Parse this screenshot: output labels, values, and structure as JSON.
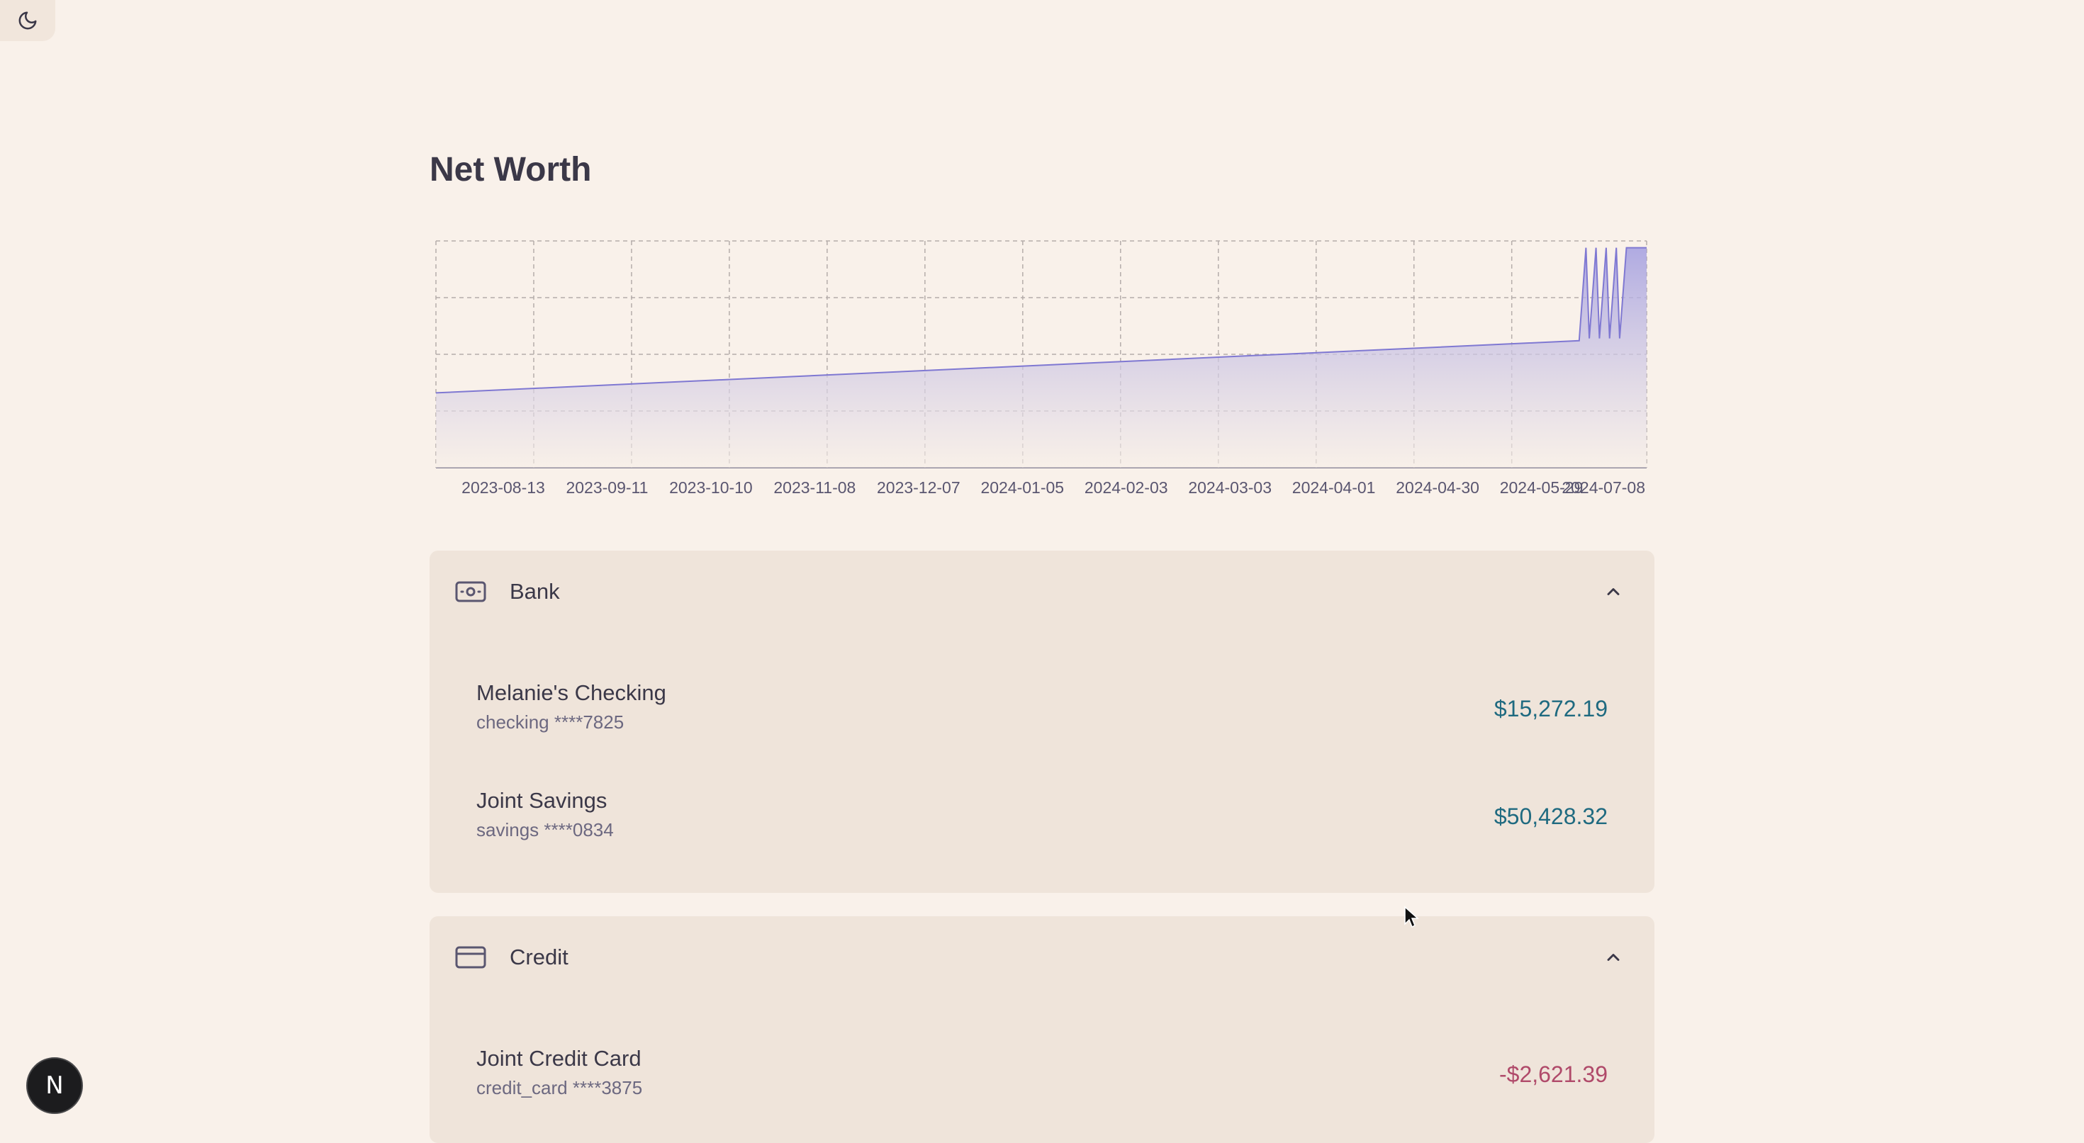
{
  "theme_toggle": {
    "icon": "moon-icon"
  },
  "page": {
    "title": "Net Worth"
  },
  "chart_data": {
    "type": "area",
    "title": "",
    "xlabel": "",
    "ylabel": "",
    "grid": true,
    "x_tick_labels": [
      "2023-08-13",
      "2023-09-11",
      "2023-10-10",
      "2023-11-08",
      "2023-12-07",
      "2024-01-05",
      "2024-02-03",
      "2024-03-03",
      "2024-04-01",
      "2024-04-30",
      "2024-05-29",
      "2024-07-08"
    ],
    "x_range": [
      "2023-07-15",
      "2024-07-08"
    ],
    "y_range": [
      0,
      1
    ],
    "series": [
      {
        "x": [
          "2023-07-15",
          "2024-06-18",
          "2024-06-20",
          "2024-06-21",
          "2024-06-23",
          "2024-06-24",
          "2024-06-26",
          "2024-06-27",
          "2024-06-29",
          "2024-06-30",
          "2024-07-02",
          "2024-07-08"
        ],
        "values": [
          0.33,
          0.56,
          0.97,
          0.57,
          0.97,
          0.57,
          0.97,
          0.57,
          0.97,
          0.57,
          0.97,
          0.97
        ]
      }
    ],
    "colors": {
      "line": "#7f78d2",
      "fill_top": "#a39ee0",
      "fill_bottom": "#f7efe8"
    }
  },
  "sections": [
    {
      "title": "Bank",
      "icon": "banknote-icon",
      "accounts": [
        {
          "name": "Melanie's Checking",
          "sub": "checking ****7825",
          "balance": "$15,272.19",
          "sign": "positive"
        },
        {
          "name": "Joint Savings",
          "sub": "savings ****0834",
          "balance": "$50,428.32",
          "sign": "positive"
        }
      ]
    },
    {
      "title": "Credit",
      "icon": "credit-card-icon",
      "accounts": [
        {
          "name": "Joint Credit Card",
          "sub": "credit_card ****3875",
          "balance": "-$2,621.39",
          "sign": "negative"
        }
      ]
    }
  ],
  "dev_badge": {
    "label": "N"
  },
  "colors": {
    "positive": "#1f6a80",
    "negative": "#b04a6a",
    "background": "#f9f1ea",
    "card": "#efe4da"
  }
}
